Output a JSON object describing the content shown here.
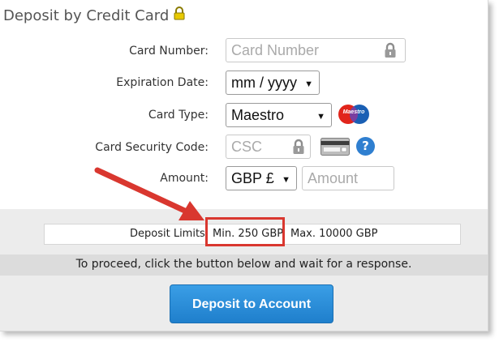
{
  "page": {
    "title": "Deposit by Credit Card"
  },
  "form": {
    "card_number": {
      "label": "Card Number:",
      "placeholder": "Card Number"
    },
    "expiration": {
      "label": "Expiration Date:",
      "value": "mm / yyyy"
    },
    "card_type": {
      "label": "Card Type:",
      "value": "Maestro",
      "logo_text": "Maestro"
    },
    "security_code": {
      "label": "Card Security Code:",
      "placeholder": "CSC",
      "help": "?"
    },
    "amount": {
      "label": "Amount:",
      "currency": "GBP £",
      "placeholder": "Amount"
    }
  },
  "limits": {
    "label": "Deposit Limits",
    "min": "Min. 250 GBP",
    "max": "Max. 10000 GBP"
  },
  "instructions": "To proceed, click the button below and wait for a response.",
  "button": {
    "label": "Deposit to Account"
  },
  "colors": {
    "accent": "#2a8ddb",
    "highlight": "#d9372f",
    "lock": "#d4b400"
  },
  "icons": [
    "lock-icon",
    "padlock-icon",
    "maestro-logo-icon",
    "card-back-icon",
    "help-icon",
    "arrow-annotation-icon"
  ]
}
